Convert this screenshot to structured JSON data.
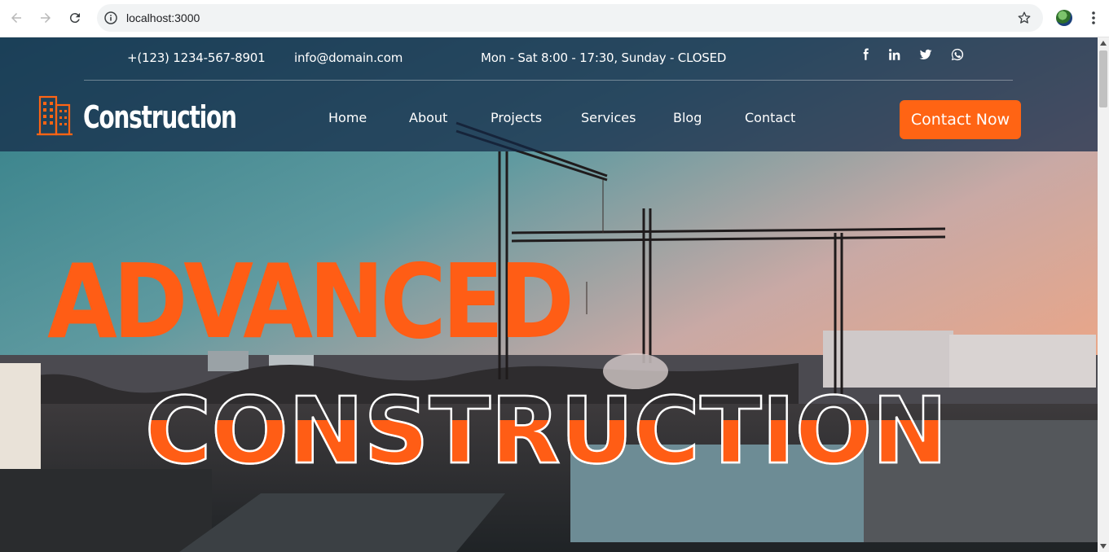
{
  "browser": {
    "url": "localhost:3000"
  },
  "topbar": {
    "phone": "+(123) 1234-567-8901",
    "email": "info@domain.com",
    "hours": "Mon - Sat 8:00 - 17:30, Sunday - CLOSED",
    "socials": [
      "facebook-icon",
      "linkedin-icon",
      "twitter-icon",
      "whatsapp-icon"
    ]
  },
  "brand": {
    "name": "Construction"
  },
  "nav": {
    "items": [
      "Home",
      "About",
      "Projects",
      "Services",
      "Blog",
      "Contact"
    ]
  },
  "cta": {
    "label": "Contact Now"
  },
  "hero": {
    "line1": "ADVANCED",
    "line2": "CONSTRUCTION"
  },
  "colors": {
    "accent": "#ff6414",
    "header_overlay": "#142846"
  }
}
